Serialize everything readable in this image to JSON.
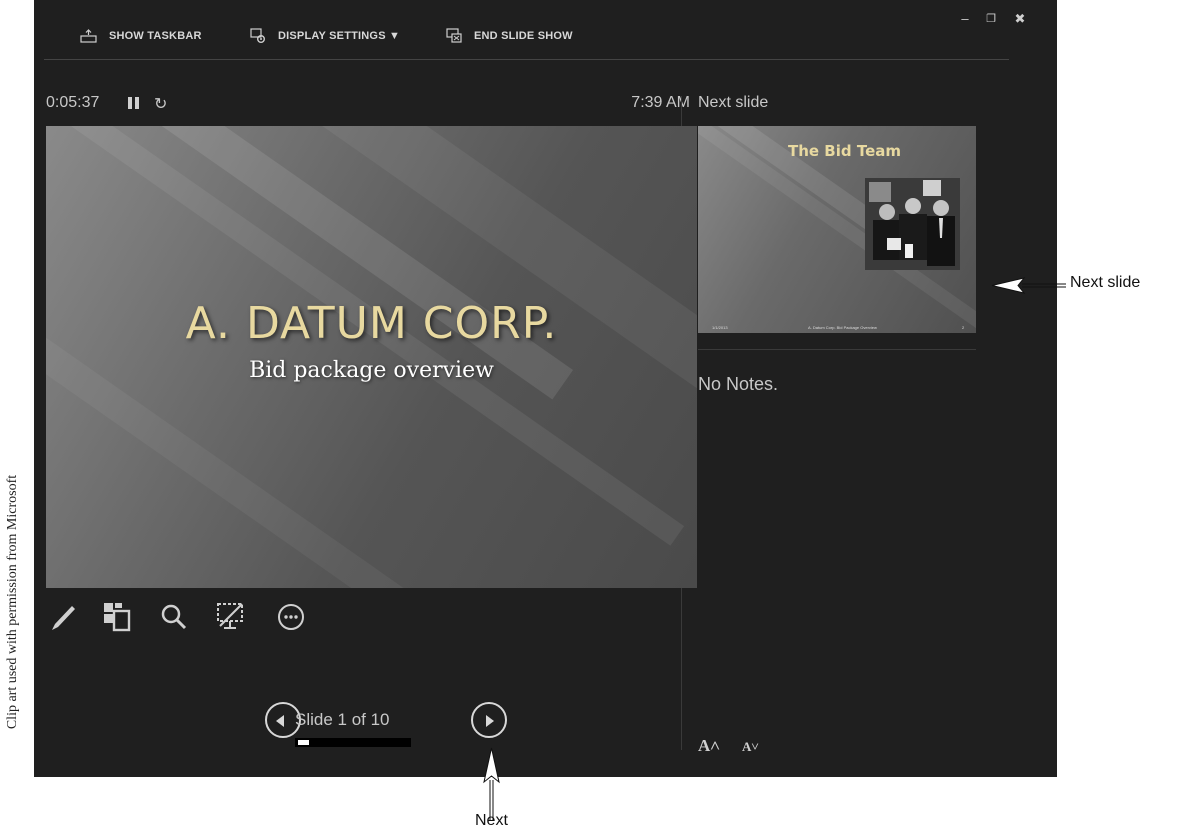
{
  "credit": "Clip art used with permission from Microsoft",
  "toolbar": {
    "show_taskbar": "SHOW TASKBAR",
    "display_settings": "DISPLAY SETTINGS ▼",
    "end_slide_show": "END SLIDE SHOW"
  },
  "window_controls": {
    "minimize": "–",
    "restore": "❐",
    "close": "✖"
  },
  "timer": {
    "elapsed": "0:05:37",
    "restart_glyph": "↻"
  },
  "clock": "7:39 AM",
  "current_slide": {
    "title": "A. DATUM CORP.",
    "subtitle": "Bid package overview"
  },
  "tools": [
    "pen-tool",
    "see-all-slides",
    "zoom",
    "black-screen",
    "more-options"
  ],
  "navigation": {
    "counter": "Slide 1 of 10",
    "progress_fraction": 0.1
  },
  "next_slide": {
    "label": "Next slide",
    "title": "The Bid Team",
    "footer_date": "1/1/2013",
    "footer_text": "A. Datum Corp. Bid Package Overview",
    "footer_page": "2"
  },
  "notes": "No Notes.",
  "font_controls": {
    "increase": "A˄",
    "decrease": "A˅"
  },
  "annotations": {
    "next_slide": "Next slide",
    "next": "Next"
  },
  "colors": {
    "window_bg": "#1f1f1f",
    "slide_title": "#e8d9a0",
    "text": "#c8c8c8"
  }
}
